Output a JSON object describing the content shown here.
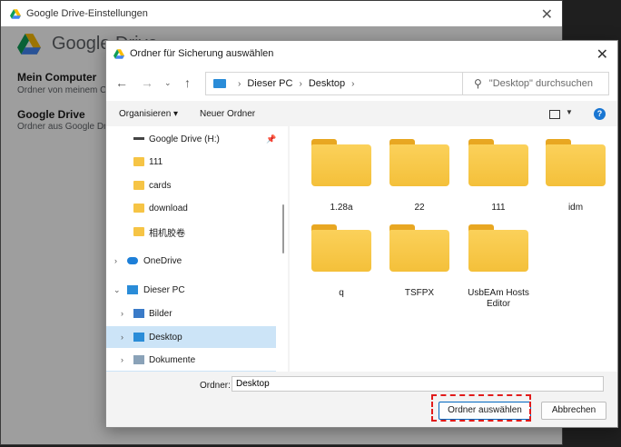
{
  "background_window": {
    "title": "Google Drive-Einstellungen",
    "brand": "Google Drive",
    "items": [
      {
        "title": "Mein Computer",
        "subtitle": "Ordner von meinem C"
      },
      {
        "title": "Google Drive",
        "subtitle": "Ordner aus Google Dr"
      }
    ]
  },
  "dialog": {
    "title": "Ordner für Sicherung auswählen",
    "breadcrumb": [
      "Dieser PC",
      "Desktop"
    ],
    "search_placeholder": "\"Desktop\" durchsuchen",
    "commands": {
      "organize": "Organisieren",
      "new_folder": "Neuer Ordner"
    },
    "nav_items": [
      {
        "label": "Google Drive (H:)",
        "icon": "drive-icon",
        "pinned": true
      },
      {
        "label": "111",
        "icon": "folder-icon"
      },
      {
        "label": "cards",
        "icon": "folder-icon"
      },
      {
        "label": "download",
        "icon": "folder-icon"
      },
      {
        "label": "相机胶卷",
        "icon": "folder-icon"
      },
      {
        "label": "OneDrive",
        "icon": "cloud-icon"
      },
      {
        "label": "Dieser PC",
        "icon": "pc-icon"
      },
      {
        "label": "Bilder",
        "icon": "pictures-icon"
      },
      {
        "label": "Desktop",
        "icon": "desktop-icon",
        "selected": true
      },
      {
        "label": "Dokumente",
        "icon": "documents-icon"
      }
    ],
    "folders": [
      "1.28a",
      "22",
      "111",
      "idm",
      "q",
      "TSFPX",
      "UsbEAm Hosts Editor"
    ],
    "folder_label": "Ordner:",
    "folder_value": "Desktop",
    "select_button": "Ordner auswählen",
    "cancel_button": "Abbrechen"
  },
  "colors": {
    "accent": "#0067c0",
    "selection": "#cce4f7",
    "highlight": "#e11b1b",
    "folder": "#f6c445"
  }
}
